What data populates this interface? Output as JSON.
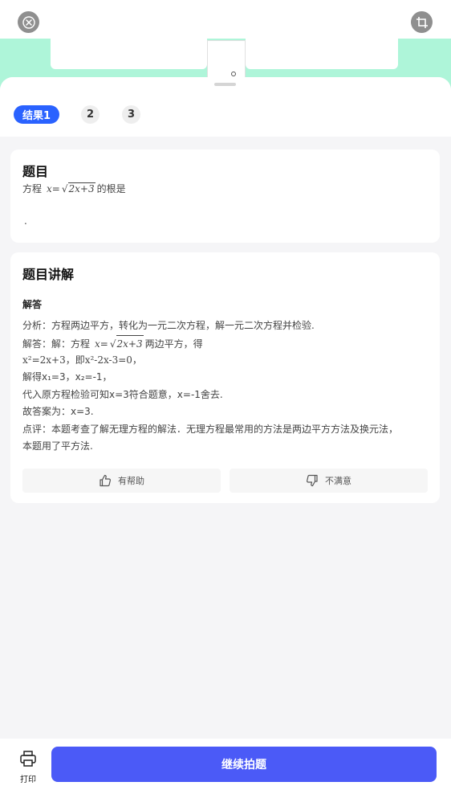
{
  "header": {
    "close_icon": "close-icon",
    "crop_icon": "crop-icon"
  },
  "tabs": [
    {
      "label": "结果1",
      "active": true
    },
    {
      "label": "2",
      "active": false
    },
    {
      "label": "3",
      "active": false
    }
  ],
  "question": {
    "title": "题目",
    "prefix": "方程",
    "lhs": "x=",
    "radicand": "2x+3",
    "suffix": "的根是",
    "tail": "."
  },
  "explanation": {
    "title": "题目讲解",
    "answer_heading": "解答",
    "lines": {
      "l1": "分析：方程两边平方，转化为一元二次方程，解一元二次方程并检验.",
      "l2_pre": "解答：解：方程",
      "l2_lhs": "x=",
      "l2_rad": "2x+3",
      "l2_post": "两边平方，得",
      "l3": "x²=2x+3，即x²-2x-3=0，",
      "l4": "解得x₁=3，x₂=-1，",
      "l5": "代入原方程检验可知x=3符合题意，x=-1舍去.",
      "l6": "故答案为：x=3.",
      "l7": "点评：本题考查了解无理方程的解法．无理方程最常用的方法是两边平方方法及换元法，",
      "l8": "本题用了平方法."
    },
    "helpful_label": "有帮助",
    "unsatisfied_label": "不满意"
  },
  "bottom": {
    "print_label": "打印",
    "continue_label": "继续拍题"
  },
  "colors": {
    "accent": "#2a62ff",
    "cta": "#4b5af7",
    "camera_band": "#aef5d9"
  }
}
